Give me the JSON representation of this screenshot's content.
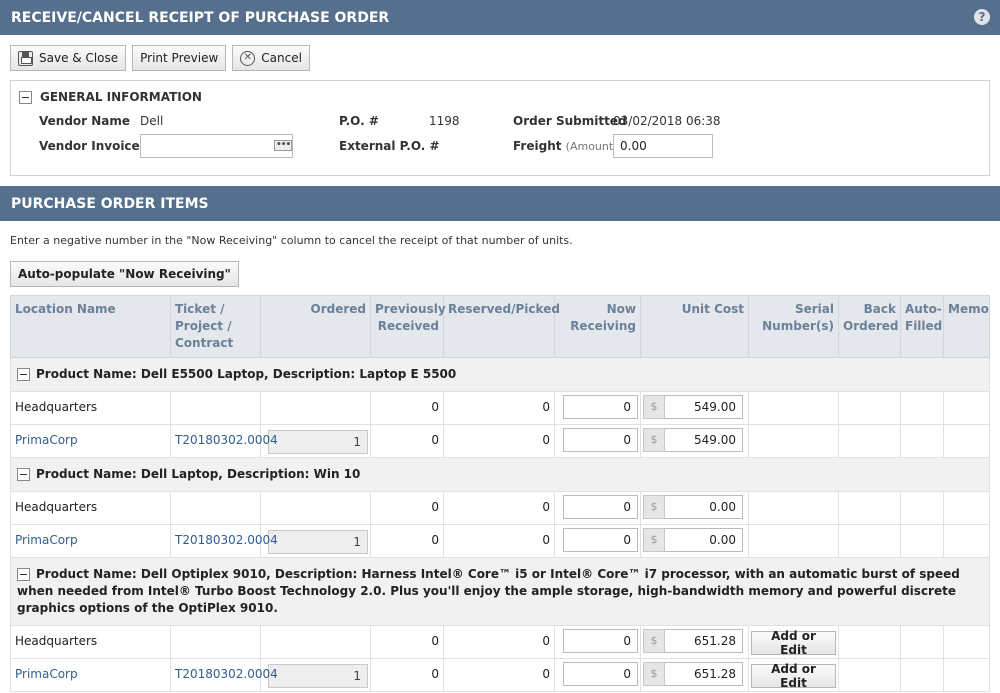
{
  "header": {
    "title": "RECEIVE/CANCEL RECEIPT OF PURCHASE ORDER",
    "help": "?"
  },
  "toolbar": {
    "save_close": "Save & Close",
    "print_preview": "Print Preview",
    "cancel": "Cancel"
  },
  "general": {
    "title": "GENERAL INFORMATION",
    "vendor_name_label": "Vendor Name",
    "vendor_name": "Dell",
    "vendor_invoice_label": "Vendor Invoice #",
    "vendor_invoice_value": "",
    "po_label": "P.O. #",
    "po_value": "1198",
    "external_po_label": "External P.O. #",
    "order_submitted_label": "Order Submitted",
    "order_submitted_value": "03/02/2018 06:38",
    "freight_label": "Freight",
    "freight_sub": "(Amount)",
    "freight_value": "0.00"
  },
  "items_section": {
    "title": "PURCHASE ORDER ITEMS",
    "instructions": "Enter a negative number in the \"Now Receiving\" column to cancel the receipt of that number of units.",
    "autopopulate": "Auto-populate \"Now Receiving\""
  },
  "columns": {
    "location": "Location Name",
    "ticket": "Ticket / Project / Contract",
    "ordered": "Ordered",
    "previously": "Previously Received",
    "reserved": "Reserved/Picked",
    "now": "Now Receiving",
    "unit_cost": "Unit Cost",
    "serial": "Serial Number(s)",
    "back": "Back Ordered",
    "auto": "Auto- Filled",
    "memo": "Memo"
  },
  "currency_symbol": "$",
  "groups": [
    {
      "label": "Product Name: Dell E5500 Laptop, Description: Laptop E 5500",
      "rows": [
        {
          "location": "Headquarters",
          "ticket": "",
          "ordered": "",
          "previously": "0",
          "reserved": "0",
          "now": "0",
          "cost": "549.00",
          "action": ""
        },
        {
          "location": "PrimaCorp",
          "ticket": "T20180302.0004",
          "ordered": "1",
          "previously": "0",
          "reserved": "0",
          "now": "0",
          "cost": "549.00",
          "action": ""
        }
      ]
    },
    {
      "label": "Product Name: Dell Laptop, Description: Win 10",
      "rows": [
        {
          "location": "Headquarters",
          "ticket": "",
          "ordered": "",
          "previously": "0",
          "reserved": "0",
          "now": "0",
          "cost": "0.00",
          "action": ""
        },
        {
          "location": "PrimaCorp",
          "ticket": "T20180302.0004",
          "ordered": "1",
          "previously": "0",
          "reserved": "0",
          "now": "0",
          "cost": "0.00",
          "action": ""
        }
      ]
    },
    {
      "label": "Product Name: Dell Optiplex 9010, Description: Harness Intel® Core™ i5 or Intel® Core™ i7 processor, with an automatic burst of speed when needed from Intel® Turbo Boost Technology 2.0. Plus you'll enjoy the ample storage, high-bandwidth memory and powerful discrete graphics options of the OptiPlex 9010.",
      "rows": [
        {
          "location": "Headquarters",
          "ticket": "",
          "ordered": "",
          "previously": "0",
          "reserved": "0",
          "now": "0",
          "cost": "651.28",
          "action": "Add or Edit"
        },
        {
          "location": "PrimaCorp",
          "ticket": "T20180302.0004",
          "ordered": "1",
          "previously": "0",
          "reserved": "0",
          "now": "0",
          "cost": "651.28",
          "action": "Add or Edit"
        }
      ]
    }
  ]
}
